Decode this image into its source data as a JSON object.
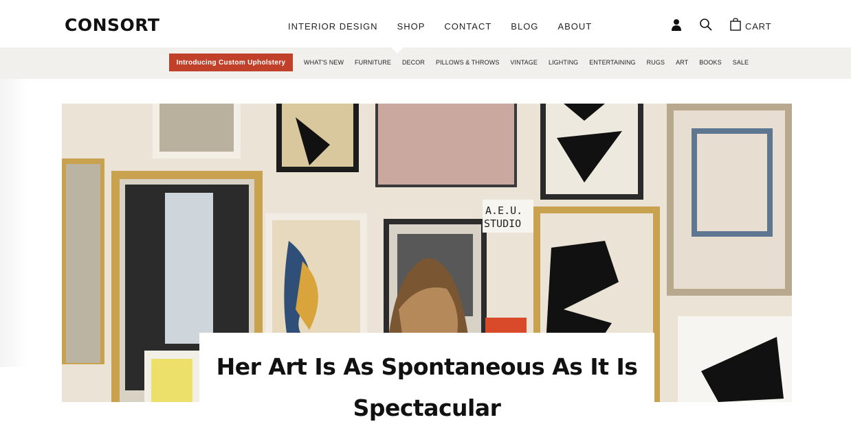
{
  "header": {
    "logo": "CONSORT",
    "nav": [
      {
        "label": "INTERIOR DESIGN"
      },
      {
        "label": "SHOP"
      },
      {
        "label": "CONTACT"
      },
      {
        "label": "BLOG"
      },
      {
        "label": "ABOUT"
      }
    ],
    "cart_label": "CART",
    "icons": {
      "account": "user-icon",
      "search": "search-icon",
      "cart": "shopping-bag-icon"
    }
  },
  "subnav": {
    "promo": "Introducing Custom Upholstery",
    "categories": [
      {
        "label": "WHAT'S NEW"
      },
      {
        "label": "FURNITURE"
      },
      {
        "label": "DECOR"
      },
      {
        "label": "PILLOWS & THROWS"
      },
      {
        "label": "VINTAGE"
      },
      {
        "label": "LIGHTING"
      },
      {
        "label": "ENTERTAINING"
      },
      {
        "label": "RUGS"
      },
      {
        "label": "ART"
      },
      {
        "label": "BOOKS"
      },
      {
        "label": "SALE"
      }
    ]
  },
  "hero": {
    "sign_line1": "A.E.U.",
    "sign_line2": "STUDIO"
  },
  "article": {
    "title": "Her Art Is As Spontaneous As It Is Spectacular"
  },
  "colors": {
    "promo_bg": "#c0402a",
    "subnav_bg": "#f1f0ec"
  }
}
